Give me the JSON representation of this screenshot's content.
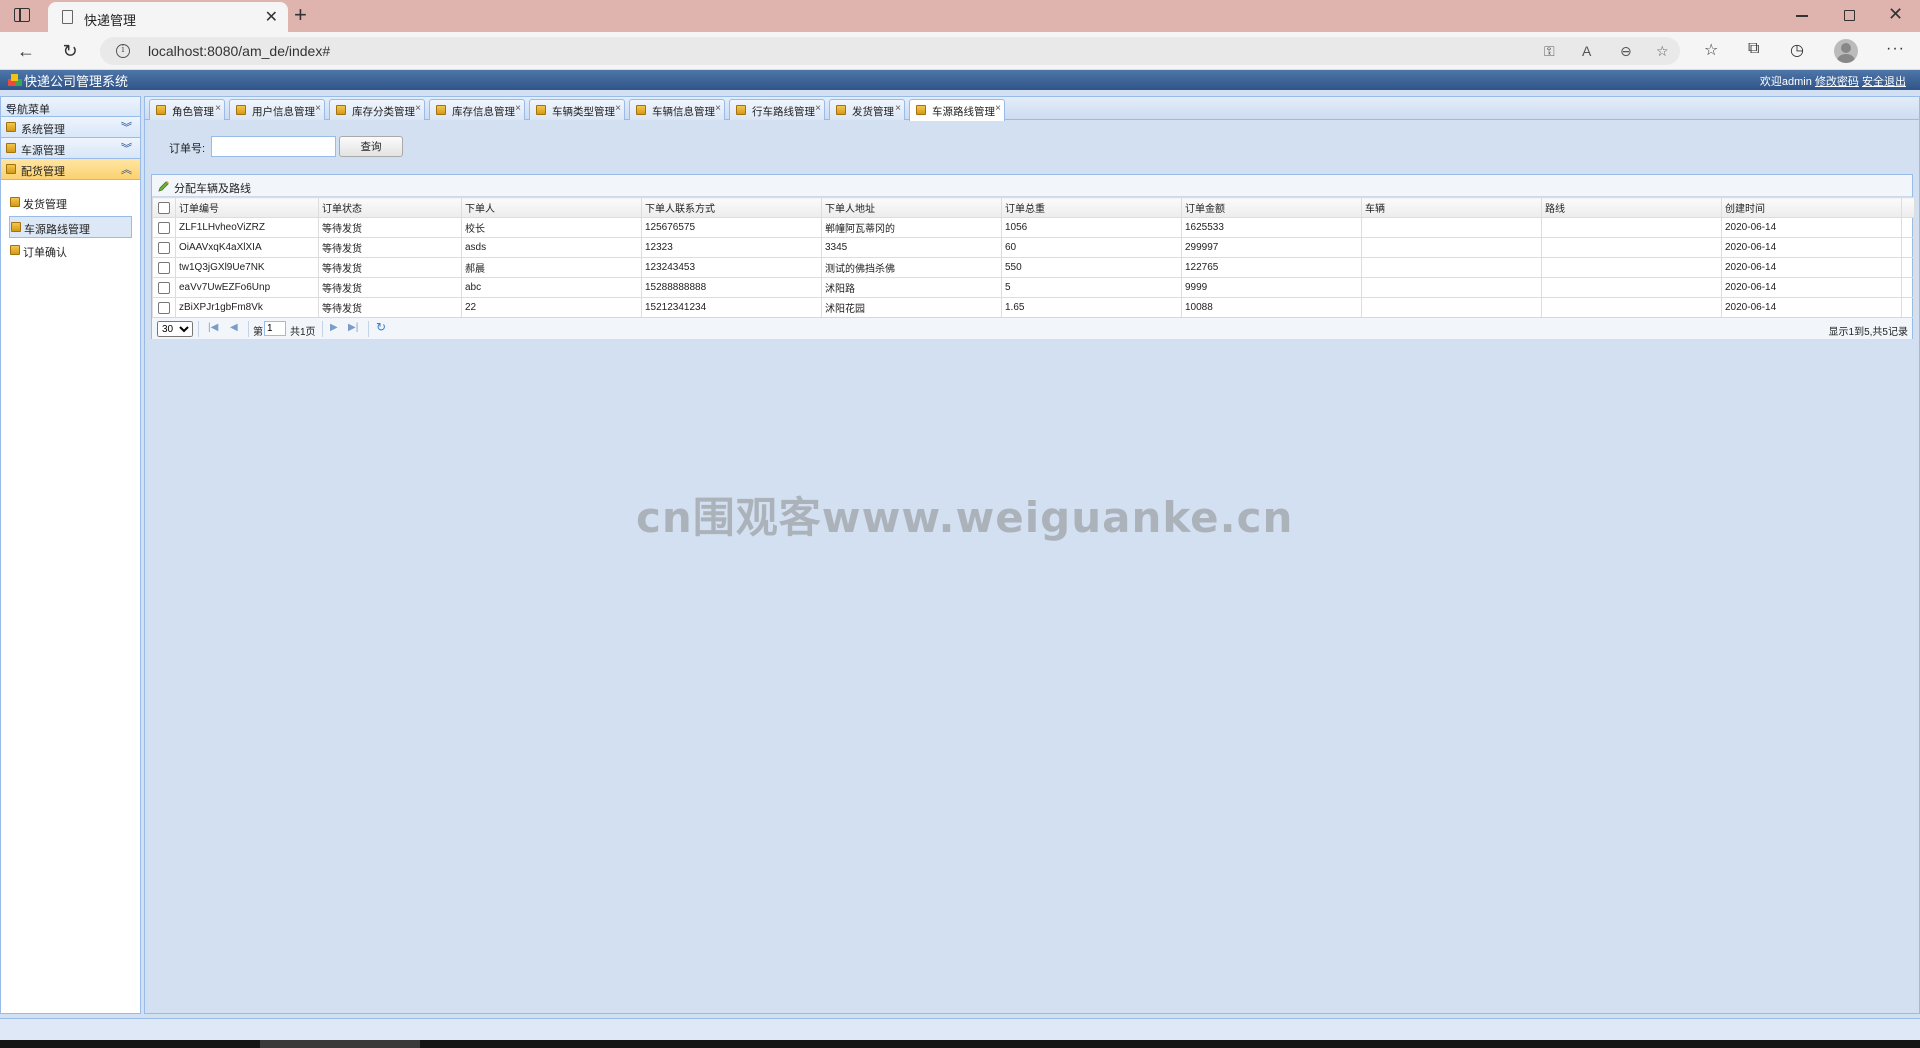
{
  "browser": {
    "tab_title": "快递管理",
    "tab_close": "✕",
    "new_tab": "+",
    "url": "localhost:8080/am_de/index#",
    "window_close": "✕"
  },
  "app": {
    "title": "快递公司管理系统",
    "welcome": "欢迎admin",
    "change_password": "修改密码",
    "logout": "安全退出"
  },
  "nav": {
    "header": "导航菜单",
    "groups": [
      {
        "label": "系统管理",
        "active": false
      },
      {
        "label": "车源管理",
        "active": false
      },
      {
        "label": "配货管理",
        "active": true
      }
    ],
    "items": [
      {
        "label": "发货管理"
      },
      {
        "label": "车源路线管理"
      },
      {
        "label": "订单确认"
      }
    ]
  },
  "tabs": [
    {
      "label": "角色管理"
    },
    {
      "label": "用户信息管理"
    },
    {
      "label": "库存分类管理"
    },
    {
      "label": "库存信息管理"
    },
    {
      "label": "车辆类型管理"
    },
    {
      "label": "车辆信息管理"
    },
    {
      "label": "行车路线管理"
    },
    {
      "label": "发货管理"
    },
    {
      "label": "车源路线管理"
    }
  ],
  "tab_close": "×",
  "search": {
    "label": "订单号:",
    "value": "",
    "button": "查询"
  },
  "toolbar": {
    "assign_label": "分配车辆及路线"
  },
  "table": {
    "columns": [
      "订单编号",
      "订单状态",
      "下单人",
      "下单人联系方式",
      "下单人地址",
      "订单总重",
      "订单金额",
      "车辆",
      "路线",
      "创建时间"
    ],
    "rows": [
      [
        "ZLF1LHvheoViZRZ",
        "等待发货",
        "校长",
        "125676575",
        "郸幢阿瓦蒂冈的",
        "1056",
        "1625533",
        "",
        "",
        "2020-06-14"
      ],
      [
        "OiAAVxqK4aXlXIA",
        "等待发货",
        "asds",
        "12323",
        "3345",
        "60",
        "299997",
        "",
        "",
        "2020-06-14"
      ],
      [
        "tw1Q3jGXl9Ue7NK",
        "等待发货",
        "郝晨",
        "123243453",
        "测试的佛挡杀佛",
        "550",
        "122765",
        "",
        "",
        "2020-06-14"
      ],
      [
        "eaVv7UwEZFo6Unp",
        "等待发货",
        "abc",
        "15288888888",
        "沭阳路",
        "5",
        "9999",
        "",
        "",
        "2020-06-14"
      ],
      [
        "zBiXPJr1gbFm8Vk",
        "等待发货",
        "22",
        "15212341234",
        "沭阳花园",
        "1.65",
        "10088",
        "",
        "",
        "2020-06-14"
      ]
    ]
  },
  "pager": {
    "page_size": "30",
    "page_prefix": "第",
    "current_page": "1",
    "total_pages": "共1页",
    "summary": "显示1到5,共5记录"
  },
  "watermark": "cn围观客www.weiguanke.cn",
  "colors": {
    "header_blue": "#2f5489",
    "panel_border": "#99bbe8",
    "active_group": "#fcd271",
    "tab_strip": "#e0b4ae"
  }
}
